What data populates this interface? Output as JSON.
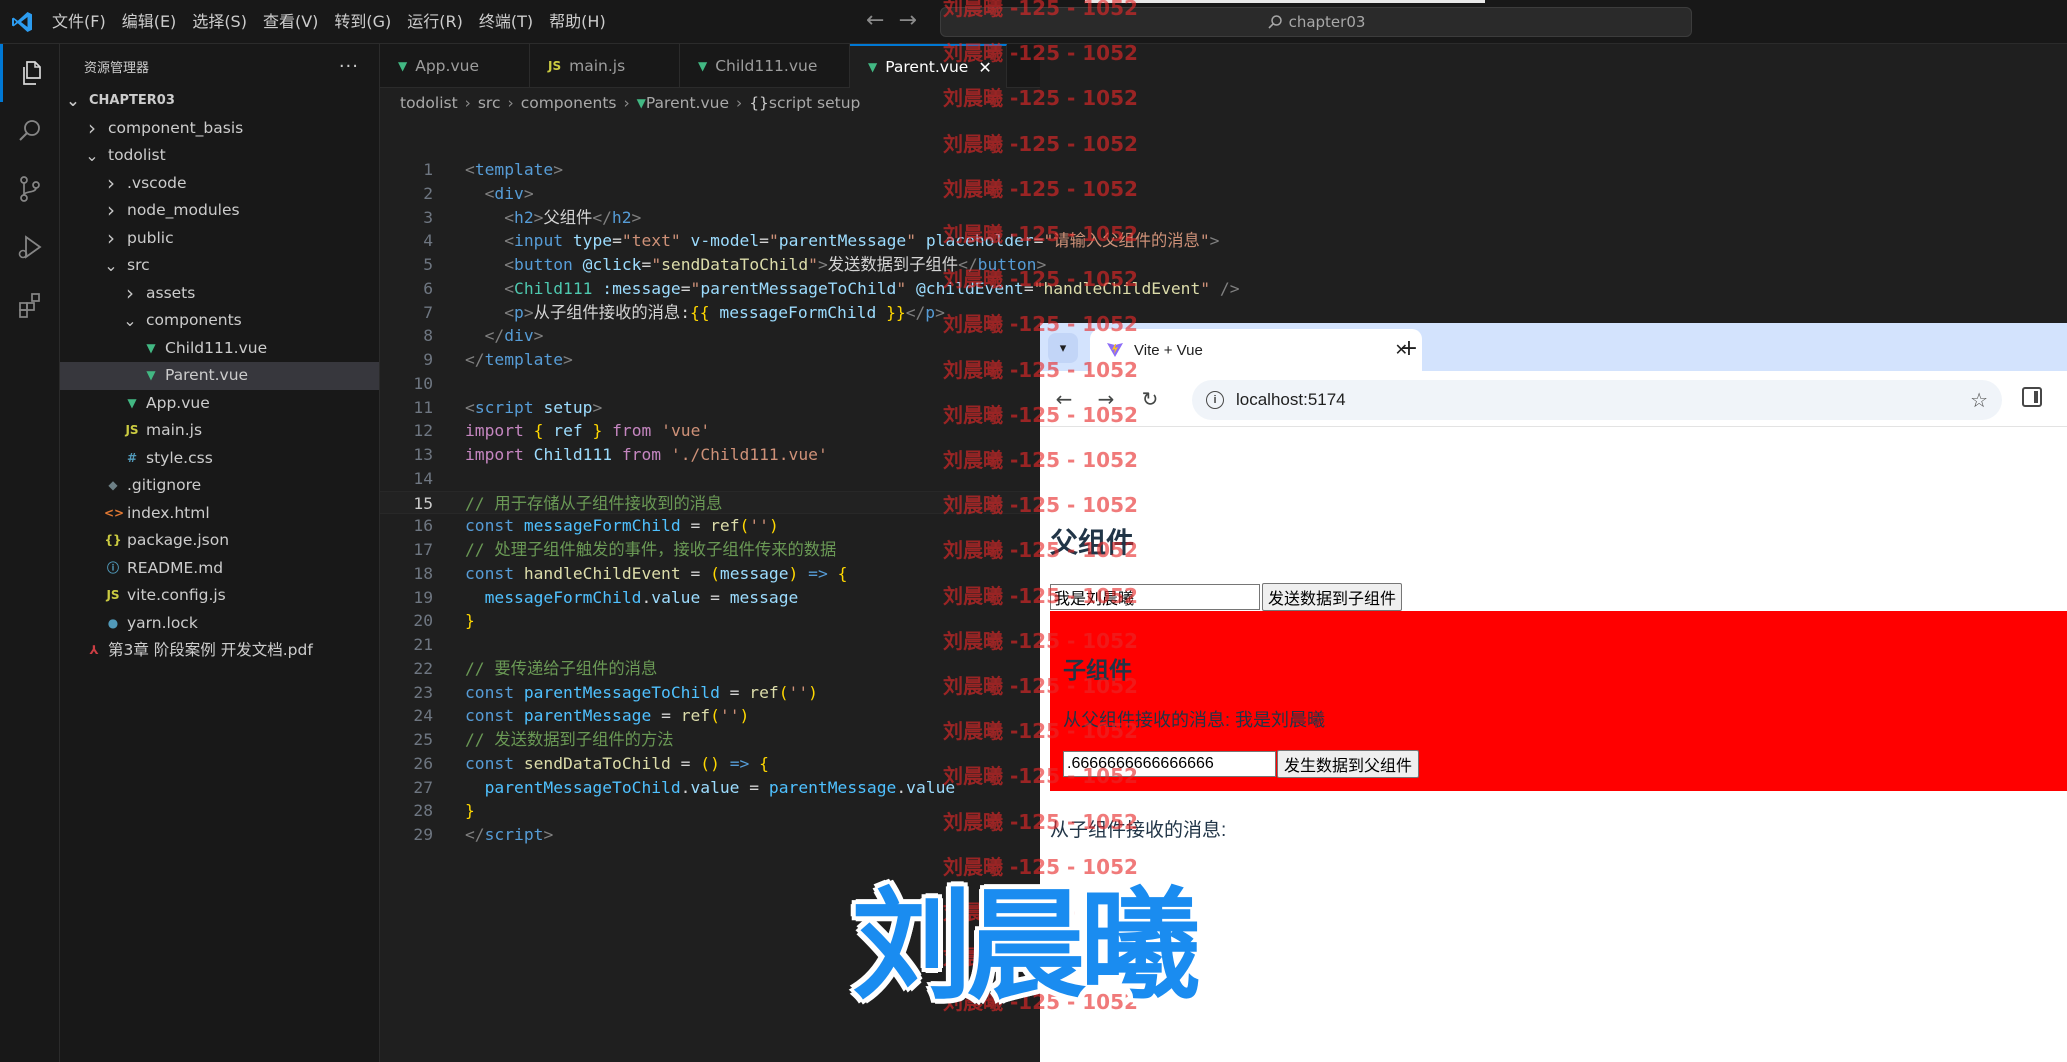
{
  "vscode": {
    "menu": [
      "文件(F)",
      "编辑(E)",
      "选择(S)",
      "查看(V)",
      "转到(G)",
      "运行(R)",
      "终端(T)",
      "帮助(H)"
    ],
    "search_placeholder": "chapter03",
    "sidebar": {
      "title": "资源管理器",
      "more": "···",
      "tree": [
        {
          "label": "CHAPTER03",
          "depth": 0,
          "kind": "folder-open",
          "bold": true
        },
        {
          "label": "component_basis",
          "depth": 1,
          "kind": "folder"
        },
        {
          "label": "todolist",
          "depth": 1,
          "kind": "folder-open"
        },
        {
          "label": ".vscode",
          "depth": 2,
          "kind": "folder"
        },
        {
          "label": "node_modules",
          "depth": 2,
          "kind": "folder"
        },
        {
          "label": "public",
          "depth": 2,
          "kind": "folder"
        },
        {
          "label": "src",
          "depth": 2,
          "kind": "folder-open"
        },
        {
          "label": "assets",
          "depth": 3,
          "kind": "folder"
        },
        {
          "label": "components",
          "depth": 3,
          "kind": "folder-open"
        },
        {
          "label": "Child111.vue",
          "depth": 4,
          "kind": "vue"
        },
        {
          "label": "Parent.vue",
          "depth": 4,
          "kind": "vue",
          "selected": true
        },
        {
          "label": "App.vue",
          "depth": 3,
          "kind": "vue"
        },
        {
          "label": "main.js",
          "depth": 3,
          "kind": "js"
        },
        {
          "label": "style.css",
          "depth": 3,
          "kind": "css"
        },
        {
          "label": ".gitignore",
          "depth": 2,
          "kind": "git"
        },
        {
          "label": "index.html",
          "depth": 2,
          "kind": "html"
        },
        {
          "label": "package.json",
          "depth": 2,
          "kind": "json"
        },
        {
          "label": "README.md",
          "depth": 2,
          "kind": "info"
        },
        {
          "label": "vite.config.js",
          "depth": 2,
          "kind": "js"
        },
        {
          "label": "yarn.lock",
          "depth": 2,
          "kind": "yarn"
        },
        {
          "label": "第3章 阶段案例 开发文档.pdf",
          "depth": 1,
          "kind": "pdf"
        }
      ]
    },
    "tabs": [
      {
        "label": "App.vue",
        "kind": "vue"
      },
      {
        "label": "main.js",
        "kind": "js"
      },
      {
        "label": "Child111.vue",
        "kind": "vue"
      },
      {
        "label": "Parent.vue",
        "kind": "vue",
        "active": true
      }
    ],
    "breadcrumb": [
      "todolist",
      "src",
      "components",
      "Parent.vue",
      "script setup"
    ],
    "code": [
      [
        [
          "t",
          "<"
        ],
        [
          "tg",
          "template"
        ],
        [
          "t",
          ">"
        ]
      ],
      [
        [
          "pl",
          "  "
        ],
        [
          "t",
          "<"
        ],
        [
          "tg",
          "div"
        ],
        [
          "t",
          ">"
        ]
      ],
      [
        [
          "pl",
          "    "
        ],
        [
          "t",
          "<"
        ],
        [
          "tg",
          "h2"
        ],
        [
          "t",
          ">"
        ],
        [
          "pl",
          "父组件"
        ],
        [
          "t",
          "</"
        ],
        [
          "tg",
          "h2"
        ],
        [
          "t",
          ">"
        ]
      ],
      [
        [
          "pl",
          "    "
        ],
        [
          "t",
          "<"
        ],
        [
          "tg",
          "input"
        ],
        [
          "pl",
          " "
        ],
        [
          "at",
          "type"
        ],
        [
          "pl",
          "="
        ],
        [
          "st",
          "\"text\""
        ],
        [
          "pl",
          " "
        ],
        [
          "at",
          "v-model"
        ],
        [
          "pl",
          "="
        ],
        [
          "st",
          "\""
        ],
        [
          "pp",
          "parentMessage"
        ],
        [
          "st",
          "\""
        ],
        [
          "pl",
          " "
        ],
        [
          "at",
          "placeholder"
        ],
        [
          "pl",
          "="
        ],
        [
          "st",
          "\"请输入父组件的消息\""
        ],
        [
          "t",
          ">"
        ]
      ],
      [
        [
          "pl",
          "    "
        ],
        [
          "t",
          "<"
        ],
        [
          "tg",
          "button"
        ],
        [
          "pl",
          " "
        ],
        [
          "at",
          "@click"
        ],
        [
          "pl",
          "="
        ],
        [
          "st",
          "\""
        ],
        [
          "fn",
          "sendDataToChild"
        ],
        [
          "st",
          "\""
        ],
        [
          "t",
          ">"
        ],
        [
          "pl",
          "发送数据到子组件"
        ],
        [
          "t",
          "</"
        ],
        [
          "tg",
          "button"
        ],
        [
          "t",
          ">"
        ]
      ],
      [
        [
          "pl",
          "    "
        ],
        [
          "t",
          "<"
        ],
        [
          "cc",
          "Child111"
        ],
        [
          "pl",
          " "
        ],
        [
          "at",
          ":message"
        ],
        [
          "pl",
          "="
        ],
        [
          "st",
          "\""
        ],
        [
          "pp",
          "parentMessageToChild"
        ],
        [
          "st",
          "\""
        ],
        [
          "pl",
          " "
        ],
        [
          "at",
          "@childEvent"
        ],
        [
          "pl",
          "="
        ],
        [
          "st",
          "\""
        ],
        [
          "fn",
          "handleChildEvent"
        ],
        [
          "st",
          "\""
        ],
        [
          "pl",
          " "
        ],
        [
          "t",
          "/>"
        ]
      ],
      [
        [
          "pl",
          "    "
        ],
        [
          "t",
          "<"
        ],
        [
          "tg",
          "p"
        ],
        [
          "t",
          ">"
        ],
        [
          "pl",
          "从子组件接收的消息:"
        ],
        [
          "br",
          "{{"
        ],
        [
          "pl",
          " "
        ],
        [
          "pp",
          "messageFormChild"
        ],
        [
          "pl",
          " "
        ],
        [
          "br",
          "}}"
        ],
        [
          "t",
          "</"
        ],
        [
          "tg",
          "p"
        ],
        [
          "t",
          ">"
        ]
      ],
      [
        [
          "pl",
          "  "
        ],
        [
          "t",
          "</"
        ],
        [
          "tg",
          "div"
        ],
        [
          "t",
          ">"
        ]
      ],
      [
        [
          "t",
          "</"
        ],
        [
          "tg",
          "template"
        ],
        [
          "t",
          ">"
        ]
      ],
      [],
      [
        [
          "t",
          "<"
        ],
        [
          "tg",
          "script"
        ],
        [
          "pl",
          " "
        ],
        [
          "at",
          "setup"
        ],
        [
          "t",
          ">"
        ]
      ],
      [
        [
          "kw",
          "import"
        ],
        [
          "pl",
          " "
        ],
        [
          "br",
          "{"
        ],
        [
          "pl",
          " "
        ],
        [
          "pp",
          "ref"
        ],
        [
          "pl",
          " "
        ],
        [
          "br",
          "}"
        ],
        [
          "pl",
          " "
        ],
        [
          "kw",
          "from"
        ],
        [
          "pl",
          " "
        ],
        [
          "st",
          "'vue'"
        ]
      ],
      [
        [
          "kw",
          "import"
        ],
        [
          "pl",
          " "
        ],
        [
          "pp",
          "Child111"
        ],
        [
          "pl",
          " "
        ],
        [
          "kw",
          "from"
        ],
        [
          "pl",
          " "
        ],
        [
          "st",
          "'./Child111.vue'"
        ]
      ],
      [],
      [
        [
          "cm",
          "// 用于存储从子组件接收到的消息"
        ]
      ],
      [
        [
          "kb",
          "const"
        ],
        [
          "pl",
          " "
        ],
        [
          "vr",
          "messageFormChild"
        ],
        [
          "pl",
          " = "
        ],
        [
          "fn",
          "ref"
        ],
        [
          "br",
          "("
        ],
        [
          "st",
          "''"
        ],
        [
          "br",
          ")"
        ]
      ],
      [
        [
          "cm",
          "// 处理子组件触发的事件，接收子组件传来的数据"
        ]
      ],
      [
        [
          "kb",
          "const"
        ],
        [
          "pl",
          " "
        ],
        [
          "fn",
          "handleChildEvent"
        ],
        [
          "pl",
          " = "
        ],
        [
          "br",
          "("
        ],
        [
          "pp",
          "message"
        ],
        [
          "br",
          ")"
        ],
        [
          "pl",
          " "
        ],
        [
          "kb",
          "=>"
        ],
        [
          "pl",
          " "
        ],
        [
          "br",
          "{"
        ]
      ],
      [
        [
          "pl",
          "  "
        ],
        [
          "vr",
          "messageFormChild"
        ],
        [
          "pl",
          "."
        ],
        [
          "pp",
          "value"
        ],
        [
          "pl",
          " = "
        ],
        [
          "pp",
          "message"
        ]
      ],
      [
        [
          "br",
          "}"
        ]
      ],
      [],
      [
        [
          "cm",
          "// 要传递给子组件的消息"
        ]
      ],
      [
        [
          "kb",
          "const"
        ],
        [
          "pl",
          " "
        ],
        [
          "vr",
          "parentMessageToChild"
        ],
        [
          "pl",
          " = "
        ],
        [
          "fn",
          "ref"
        ],
        [
          "br",
          "("
        ],
        [
          "st",
          "''"
        ],
        [
          "br",
          ")"
        ]
      ],
      [
        [
          "kb",
          "const"
        ],
        [
          "pl",
          " "
        ],
        [
          "vr",
          "parentMessage"
        ],
        [
          "pl",
          " = "
        ],
        [
          "fn",
          "ref"
        ],
        [
          "br",
          "("
        ],
        [
          "st",
          "''"
        ],
        [
          "br",
          ")"
        ]
      ],
      [
        [
          "cm",
          "// 发送数据到子组件的方法"
        ]
      ],
      [
        [
          "kb",
          "const"
        ],
        [
          "pl",
          " "
        ],
        [
          "fn",
          "sendDataToChild"
        ],
        [
          "pl",
          " = "
        ],
        [
          "br",
          "()"
        ],
        [
          "pl",
          " "
        ],
        [
          "kb",
          "=>"
        ],
        [
          "pl",
          " "
        ],
        [
          "br",
          "{"
        ]
      ],
      [
        [
          "pl",
          "  "
        ],
        [
          "vr",
          "parentMessageToChild"
        ],
        [
          "pl",
          "."
        ],
        [
          "pp",
          "value"
        ],
        [
          "pl",
          " = "
        ],
        [
          "vr",
          "parentMessage"
        ],
        [
          "pl",
          "."
        ],
        [
          "pp",
          "value"
        ]
      ],
      [
        [
          "br",
          "}"
        ]
      ],
      [
        [
          "t",
          "</"
        ],
        [
          "tg",
          "script"
        ],
        [
          "t",
          ">"
        ]
      ]
    ],
    "current_line": 15
  },
  "browser": {
    "tab_title": "Vite + Vue",
    "url": "localhost:5174",
    "page": {
      "parent_title": "父组件",
      "parent_input_value": "我是刘晨曦",
      "parent_input_placeholder": "请输入父组件的消息",
      "send_to_child_label": "发送数据到子组件",
      "child_title": "子组件",
      "child_received_text": "从父组件接收的消息: 我是刘晨曦",
      "child_input_value": ".6666666666666666",
      "send_to_parent_label": "发生数据到父组件",
      "parent_received_text": "从子组件接收的消息:",
      "child_bg_color": "#ff0000"
    }
  },
  "overlay": {
    "watermark_text": "刘晨曦 -125 - 1052",
    "watermark_count": 23,
    "big_text": "刘晨曦"
  }
}
